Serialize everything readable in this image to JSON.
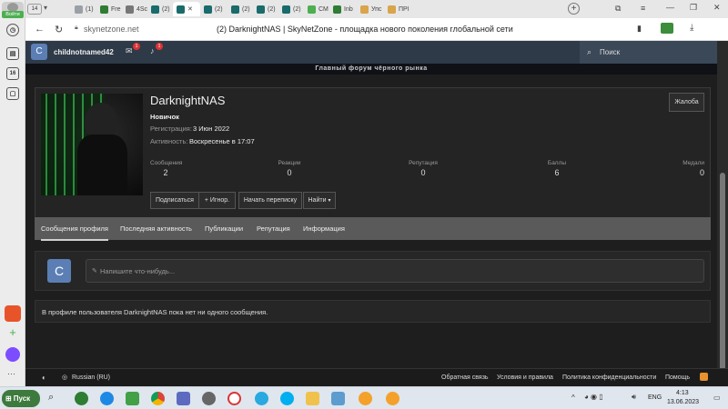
{
  "browser": {
    "tab_count": "14",
    "tabs": [
      {
        "label": "(1)",
        "color": "#9aa0a6"
      },
      {
        "label": "Fre",
        "color": "#2e7d32"
      },
      {
        "label": "4Sc",
        "color": "#777"
      },
      {
        "label": "(2)",
        "color": "#1a6b6b"
      },
      {
        "label": "(2)",
        "color": "#1a6b6b"
      },
      {
        "label": "(2)",
        "color": "#1a6b6b"
      },
      {
        "label": "(2)",
        "color": "#1a6b6b"
      },
      {
        "label": "(2)",
        "color": "#1a6b6b"
      },
      {
        "label": "CM",
        "color": "#4caf50"
      },
      {
        "label": "Inb",
        "color": "#2e7d32"
      },
      {
        "label": "Упс",
        "color": "#d9a44a"
      },
      {
        "label": "ПРІ",
        "color": "#d9a44a"
      }
    ],
    "active_tab_label": "",
    "url": "skynetzone.net",
    "page_title": "(2) DarknightNAS | SkyNetZone - площадка нового поколения глобальной сети",
    "rail_badge": "Войти",
    "rail_item": "16"
  },
  "site": {
    "username": "childnotnamed42",
    "avatar_letter": "C",
    "messages_badge": "1",
    "alerts_badge": "1",
    "search_label": "Поиск",
    "banner_text": "Главный форум чёрного рынка"
  },
  "profile": {
    "name": "DarknightNAS",
    "rank": "Новичок",
    "reg_label": "Регистрация:",
    "reg_value": "3 Июн 2022",
    "activity_label": "Активность:",
    "activity_value": "Воскресенье в 17:07",
    "report_button": "Жалоба",
    "stats": [
      {
        "label": "Сообщения",
        "value": "2"
      },
      {
        "label": "Реакции",
        "value": "0"
      },
      {
        "label": "Репутация",
        "value": "0"
      },
      {
        "label": "Баллы",
        "value": "6"
      },
      {
        "label": "Медали",
        "value": "0"
      }
    ],
    "follow_button": "Подписаться",
    "ignore_button": "+ Игнор.",
    "conversation_button": "Начать переписку",
    "find_button": "Найти"
  },
  "profile_tabs": [
    "Сообщения профиля",
    "Последняя активность",
    "Публикации",
    "Репутация",
    "Информация"
  ],
  "poster": {
    "avatar_letter": "C",
    "placeholder": "Напишите что-нибудь..."
  },
  "empty_message": "В профиле пользователя DarknightNAS пока нет ни одного сообщения.",
  "footer": {
    "language": "Russian (RU)",
    "links": [
      "Обратная связь",
      "Условия и правила",
      "Политика конфиденциальности",
      "Помощь"
    ]
  },
  "taskbar": {
    "start": "Пуск",
    "lang": "ENG",
    "time": "4:13",
    "date": "13.06.2023"
  }
}
